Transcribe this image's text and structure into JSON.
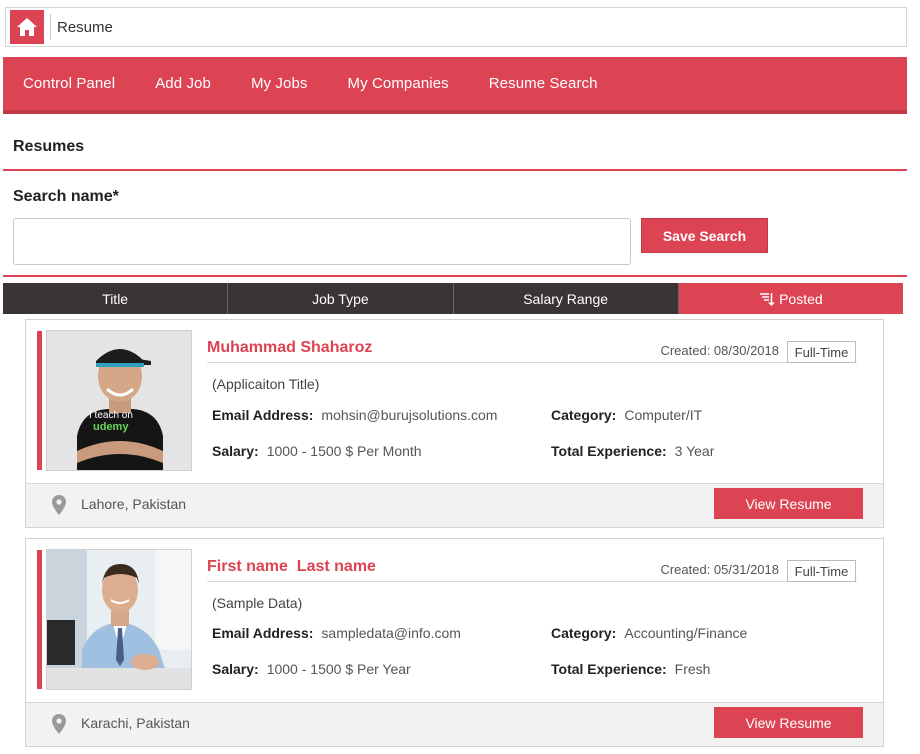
{
  "breadcrumb": {
    "label": "Resume"
  },
  "nav": {
    "items": [
      "Control Panel",
      "Add Job",
      "My Jobs",
      "My Companies",
      "Resume Search"
    ]
  },
  "section_title": "Resumes",
  "search": {
    "label": "Search name*",
    "value": "",
    "placeholder": "",
    "save_label": "Save Search"
  },
  "sort": {
    "tabs": [
      "Title",
      "Job Type",
      "Salary Range",
      "Posted"
    ],
    "active": "Posted"
  },
  "colors": {
    "accent": "#dc4453",
    "dark": "#3a3435"
  },
  "resumes": [
    {
      "name": "Muhammad Shaharoz",
      "created": "Created: 08/30/2018",
      "job_type": "Full-Time",
      "app_title": "(Applicaiton Title)",
      "email_label": "Email Address:",
      "email": "mohsin@burujsolutions.com",
      "category_label": "Category:",
      "category": "Computer/IT",
      "salary_label": "Salary:",
      "salary": "1000 - 1500 $ Per Month",
      "exp_label": "Total Experience:",
      "experience": "3 Year",
      "location": "Lahore, Pakistan",
      "view_label": "View Resume",
      "shirt_text_1": "I teach on",
      "shirt_text_2": "udemy"
    },
    {
      "name": "First name  Last name",
      "created": "Created: 05/31/2018",
      "job_type": "Full-Time",
      "app_title": "(Sample Data)",
      "email_label": "Email Address:",
      "email": "sampledata@info.com",
      "category_label": "Category:",
      "category": "Accounting/Finance",
      "salary_label": "Salary:",
      "salary": "1000 - 1500 $ Per Year",
      "exp_label": "Total Experience:",
      "experience": "Fresh",
      "location": "Karachi, Pakistan",
      "view_label": "View Resume"
    }
  ]
}
